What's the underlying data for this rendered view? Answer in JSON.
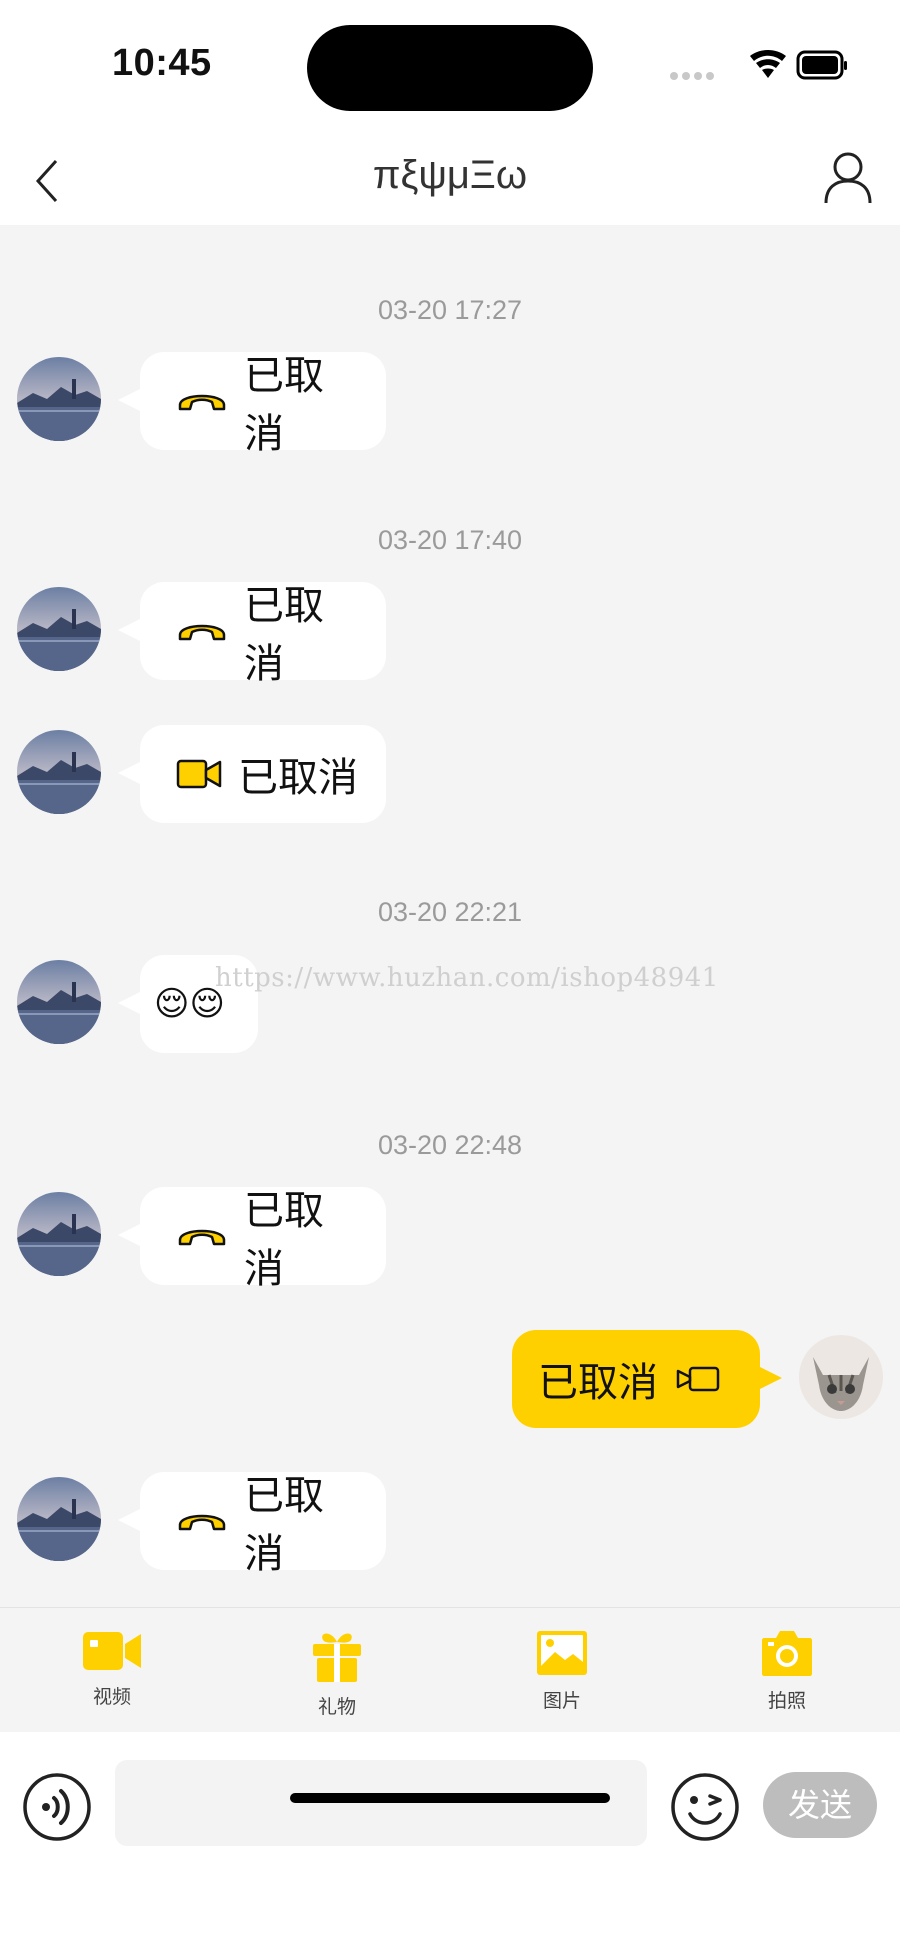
{
  "status_bar": {
    "time": "10:45"
  },
  "nav": {
    "title": "πξψμΞω"
  },
  "messages": [
    {
      "type": "timestamp",
      "text": "03-20 17:27"
    },
    {
      "type": "call",
      "direction": "in",
      "icon": "phone-hangup-icon",
      "text": "已取消"
    },
    {
      "type": "timestamp",
      "text": "03-20 17:40"
    },
    {
      "type": "call",
      "direction": "in",
      "icon": "phone-hangup-icon",
      "text": "已取消"
    },
    {
      "type": "call",
      "direction": "in",
      "icon": "video-camera-icon",
      "text": "已取消"
    },
    {
      "type": "timestamp",
      "text": "03-20 22:21"
    },
    {
      "type": "emoji",
      "direction": "in",
      "text": "😌😌"
    },
    {
      "type": "timestamp",
      "text": "03-20 22:48"
    },
    {
      "type": "call",
      "direction": "in",
      "icon": "phone-hangup-icon",
      "text": "已取消"
    },
    {
      "type": "call",
      "direction": "out",
      "icon": "video-camera-outline-icon",
      "text": "已取消"
    },
    {
      "type": "call",
      "direction": "in",
      "icon": "phone-hangup-icon",
      "text": "已取消"
    }
  ],
  "watermark": "https://www.huzhan.com/ishop48941",
  "toolbar": {
    "items": [
      {
        "label": "视频",
        "icon": "video-icon"
      },
      {
        "label": "礼物",
        "icon": "gift-icon"
      },
      {
        "label": "图片",
        "icon": "image-icon"
      },
      {
        "label": "拍照",
        "icon": "camera-icon"
      }
    ]
  },
  "input": {
    "placeholder": "",
    "value": ""
  },
  "send_label": "发送",
  "colors": {
    "accent": "#FFD000",
    "background": "#F4F4F4",
    "bubble_in": "#FFFFFF",
    "send_disabled": "#BDBDBD"
  }
}
